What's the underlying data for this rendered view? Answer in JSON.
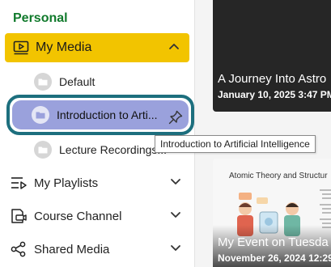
{
  "sidebar": {
    "section_title": "Personal",
    "my_media": {
      "label": "My Media",
      "icon": "media-player-icon",
      "expanded": true
    },
    "folders": [
      {
        "label": "Default",
        "icon": "folder-icon"
      },
      {
        "label": "Introduction to Arti...",
        "icon": "folder-icon",
        "active": true,
        "pin_icon": "pin-icon"
      },
      {
        "label": "Lecture Recordings...",
        "icon": "folder-icon"
      }
    ],
    "tooltip": "Introduction to Artificial Intelligence",
    "nav": [
      {
        "label": "My Playlists",
        "icon": "playlist-icon"
      },
      {
        "label": "Course Channel",
        "icon": "course-channel-icon"
      },
      {
        "label": "Shared Media",
        "icon": "share-icon"
      }
    ]
  },
  "main": {
    "cards": [
      {
        "title": "A Journey Into Astro",
        "date": "January 10, 2025 3:47 PM"
      },
      {
        "slide_title": "Atomic Theory and Structur",
        "title": "My Event on Tuesda",
        "date": "November 26, 2024 12:29"
      }
    ]
  },
  "colors": {
    "section_title": "#117a2c",
    "my_media_bg": "#f2c400",
    "active_border": "#1d6f7e",
    "active_bg": "#9aa1dc"
  }
}
